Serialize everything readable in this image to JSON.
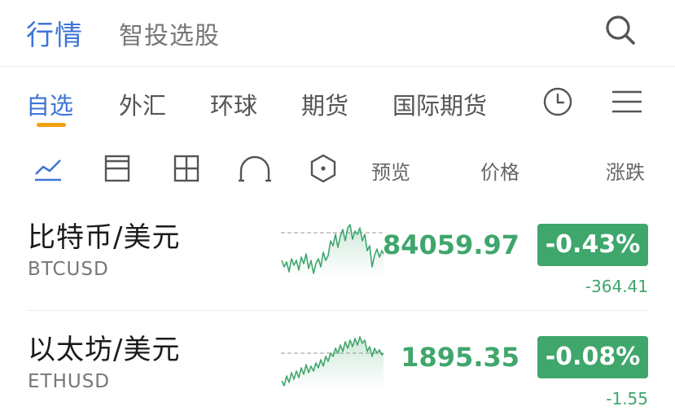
{
  "header": {
    "tabs": [
      {
        "label": "行情",
        "active": true
      },
      {
        "label": "智投选股",
        "active": false
      }
    ],
    "search_icon": "search-icon"
  },
  "categories": {
    "tabs": [
      {
        "label": "自选",
        "active": true
      },
      {
        "label": "外汇",
        "active": false
      },
      {
        "label": "环球",
        "active": false
      },
      {
        "label": "期货",
        "active": false
      },
      {
        "label": "国际期货",
        "active": false
      }
    ],
    "clock_icon": "clock-icon",
    "menu_icon": "menu-icon"
  },
  "view_modes": {
    "icons": [
      "line-chart-view-icon",
      "split-view-icon",
      "grid-view-icon",
      "arc-view-icon",
      "hexagon-view-icon"
    ],
    "active": 0
  },
  "columns": {
    "preview": "预览",
    "price": "价格",
    "change": "涨跌"
  },
  "assets": [
    {
      "name": "比特币/美元",
      "code": "BTCUSD",
      "price": "84059.97",
      "change_pct": "-0.43%",
      "change_abs": "-364.41"
    },
    {
      "name": "以太坊/美元",
      "code": "ETHUSD",
      "price": "1895.35",
      "change_pct": "-0.08%",
      "change_abs": "-1.55"
    }
  ],
  "colors": {
    "accent_blue": "#3d74d6",
    "active_underline": "#f2a20e",
    "down_green": "#3fa66c"
  }
}
